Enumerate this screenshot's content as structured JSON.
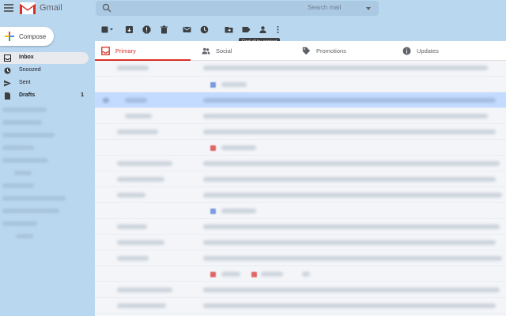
{
  "app": {
    "brand": "Gmail"
  },
  "search": {
    "placeholder": "Search mail"
  },
  "compose": {
    "label": "Compose"
  },
  "nav": {
    "items": [
      {
        "label": "Inbox",
        "count": "",
        "active": true
      },
      {
        "label": "Snoozed",
        "count": "",
        "active": false
      },
      {
        "label": "Sent",
        "count": "",
        "active": false
      },
      {
        "label": "Drafts",
        "count": "1",
        "active": false
      }
    ]
  },
  "toolbar": {
    "icons": [
      "select-checkbox-icon",
      "archive-icon",
      "report-spam-icon",
      "delete-icon",
      "mark-unread-icon",
      "snooze-icon",
      "move-to-icon",
      "labels-icon",
      "find-by-contact-icon",
      "more-icon"
    ],
    "tooltip": "Find all by contact"
  },
  "tabs": [
    {
      "label": "Primary",
      "icon": "inbox-icon",
      "active": true
    },
    {
      "label": "Social",
      "icon": "people-icon",
      "active": false
    },
    {
      "label": "Promotions",
      "icon": "tag-icon",
      "active": false
    },
    {
      "label": "Updates",
      "icon": "info-icon",
      "active": false
    }
  ],
  "colors": {
    "accent": "#d93025",
    "selected_row": "#c2dbff",
    "blue_chip": "#7c9ce0",
    "red_chip": "#e06666"
  }
}
